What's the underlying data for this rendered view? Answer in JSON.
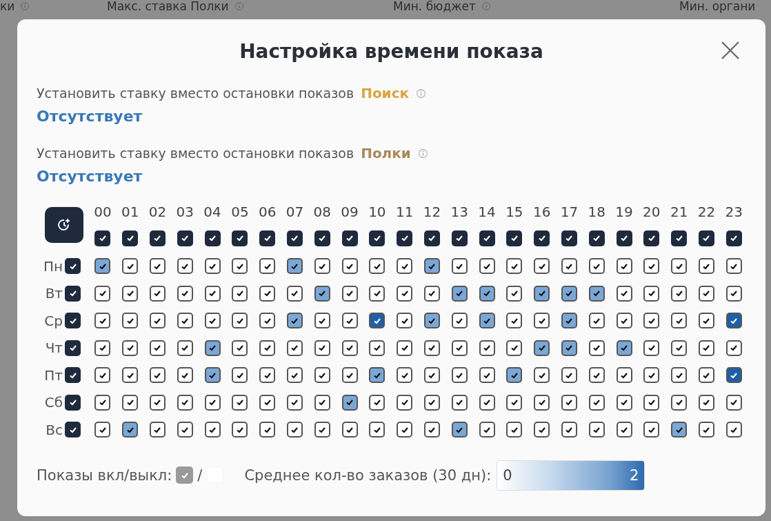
{
  "background_header": {
    "columns": [
      "ки",
      "Макс. ставка Полки",
      "Мин. бюджет",
      "Мин. органи"
    ]
  },
  "dialog": {
    "title": "Настройка времени показа",
    "bid_settings": [
      {
        "label": "Установить ставку вместо остановки показов",
        "placement": "Поиск",
        "color": "#d9a441",
        "value": "Отсутствует"
      },
      {
        "label": "Установить ставку вместо остановки показов",
        "placement": "Полки",
        "color": "#a98a5c",
        "value": "Отсутствует"
      }
    ],
    "schedule": {
      "hours": [
        "00",
        "01",
        "02",
        "03",
        "04",
        "05",
        "06",
        "07",
        "08",
        "09",
        "10",
        "11",
        "12",
        "13",
        "14",
        "15",
        "16",
        "17",
        "18",
        "19",
        "20",
        "21",
        "22",
        "23"
      ],
      "hour_checks": [
        true,
        true,
        true,
        true,
        true,
        true,
        true,
        true,
        true,
        true,
        true,
        true,
        true,
        true,
        true,
        true,
        true,
        true,
        true,
        true,
        true,
        true,
        true,
        true
      ],
      "days": [
        {
          "label": "Пн",
          "checked": true,
          "cells": [
            {
              "checked": true,
              "color": "#7aa7d6"
            },
            {
              "checked": true,
              "color": "#ffffff"
            },
            {
              "checked": true,
              "color": "#ffffff"
            },
            {
              "checked": true,
              "color": "#ffffff"
            },
            {
              "checked": true,
              "color": "#ffffff"
            },
            {
              "checked": true,
              "color": "#ffffff"
            },
            {
              "checked": true,
              "color": "#ffffff"
            },
            {
              "checked": true,
              "color": "#7aa7d6"
            },
            {
              "checked": true,
              "color": "#ffffff"
            },
            {
              "checked": true,
              "color": "#ffffff"
            },
            {
              "checked": true,
              "color": "#ffffff"
            },
            {
              "checked": true,
              "color": "#ffffff"
            },
            {
              "checked": true,
              "color": "#7aa7d6"
            },
            {
              "checked": true,
              "color": "#ffffff"
            },
            {
              "checked": true,
              "color": "#ffffff"
            },
            {
              "checked": true,
              "color": "#ffffff"
            },
            {
              "checked": true,
              "color": "#ffffff"
            },
            {
              "checked": true,
              "color": "#ffffff"
            },
            {
              "checked": true,
              "color": "#ffffff"
            },
            {
              "checked": true,
              "color": "#ffffff"
            },
            {
              "checked": true,
              "color": "#ffffff"
            },
            {
              "checked": true,
              "color": "#ffffff"
            },
            {
              "checked": true,
              "color": "#ffffff"
            },
            {
              "checked": true,
              "color": "#ffffff"
            }
          ]
        },
        {
          "label": "Вт",
          "checked": true,
          "cells": [
            {
              "checked": true,
              "color": "#ffffff"
            },
            {
              "checked": true,
              "color": "#ffffff"
            },
            {
              "checked": true,
              "color": "#ffffff"
            },
            {
              "checked": true,
              "color": "#ffffff"
            },
            {
              "checked": true,
              "color": "#ffffff"
            },
            {
              "checked": true,
              "color": "#ffffff"
            },
            {
              "checked": true,
              "color": "#ffffff"
            },
            {
              "checked": true,
              "color": "#ffffff"
            },
            {
              "checked": true,
              "color": "#7aa7d6"
            },
            {
              "checked": true,
              "color": "#ffffff"
            },
            {
              "checked": true,
              "color": "#ffffff"
            },
            {
              "checked": true,
              "color": "#ffffff"
            },
            {
              "checked": true,
              "color": "#ffffff"
            },
            {
              "checked": true,
              "color": "#7aa7d6"
            },
            {
              "checked": true,
              "color": "#7aa7d6"
            },
            {
              "checked": true,
              "color": "#ffffff"
            },
            {
              "checked": true,
              "color": "#7aa7d6"
            },
            {
              "checked": true,
              "color": "#7aa7d6"
            },
            {
              "checked": true,
              "color": "#7aa7d6"
            },
            {
              "checked": true,
              "color": "#ffffff"
            },
            {
              "checked": true,
              "color": "#ffffff"
            },
            {
              "checked": true,
              "color": "#ffffff"
            },
            {
              "checked": true,
              "color": "#ffffff"
            },
            {
              "checked": true,
              "color": "#ffffff"
            }
          ]
        },
        {
          "label": "Ср",
          "checked": true,
          "cells": [
            {
              "checked": true,
              "color": "#ffffff"
            },
            {
              "checked": true,
              "color": "#ffffff"
            },
            {
              "checked": true,
              "color": "#ffffff"
            },
            {
              "checked": true,
              "color": "#ffffff"
            },
            {
              "checked": true,
              "color": "#ffffff"
            },
            {
              "checked": true,
              "color": "#ffffff"
            },
            {
              "checked": true,
              "color": "#ffffff"
            },
            {
              "checked": true,
              "color": "#7aa7d6"
            },
            {
              "checked": true,
              "color": "#ffffff"
            },
            {
              "checked": true,
              "color": "#ffffff"
            },
            {
              "checked": true,
              "color": "#1f5fa8"
            },
            {
              "checked": true,
              "color": "#ffffff"
            },
            {
              "checked": true,
              "color": "#7aa7d6"
            },
            {
              "checked": true,
              "color": "#ffffff"
            },
            {
              "checked": true,
              "color": "#7aa7d6"
            },
            {
              "checked": true,
              "color": "#ffffff"
            },
            {
              "checked": true,
              "color": "#ffffff"
            },
            {
              "checked": true,
              "color": "#7aa7d6"
            },
            {
              "checked": true,
              "color": "#ffffff"
            },
            {
              "checked": true,
              "color": "#ffffff"
            },
            {
              "checked": true,
              "color": "#ffffff"
            },
            {
              "checked": true,
              "color": "#ffffff"
            },
            {
              "checked": true,
              "color": "#ffffff"
            },
            {
              "checked": true,
              "color": "#1f5fa8"
            }
          ]
        },
        {
          "label": "Чт",
          "checked": true,
          "cells": [
            {
              "checked": true,
              "color": "#ffffff"
            },
            {
              "checked": true,
              "color": "#ffffff"
            },
            {
              "checked": true,
              "color": "#ffffff"
            },
            {
              "checked": true,
              "color": "#ffffff"
            },
            {
              "checked": true,
              "color": "#7aa7d6"
            },
            {
              "checked": true,
              "color": "#ffffff"
            },
            {
              "checked": true,
              "color": "#ffffff"
            },
            {
              "checked": true,
              "color": "#ffffff"
            },
            {
              "checked": true,
              "color": "#ffffff"
            },
            {
              "checked": true,
              "color": "#ffffff"
            },
            {
              "checked": true,
              "color": "#ffffff"
            },
            {
              "checked": true,
              "color": "#ffffff"
            },
            {
              "checked": true,
              "color": "#ffffff"
            },
            {
              "checked": true,
              "color": "#ffffff"
            },
            {
              "checked": true,
              "color": "#ffffff"
            },
            {
              "checked": true,
              "color": "#ffffff"
            },
            {
              "checked": true,
              "color": "#7aa7d6"
            },
            {
              "checked": true,
              "color": "#7aa7d6"
            },
            {
              "checked": true,
              "color": "#ffffff"
            },
            {
              "checked": true,
              "color": "#7aa7d6"
            },
            {
              "checked": true,
              "color": "#ffffff"
            },
            {
              "checked": true,
              "color": "#ffffff"
            },
            {
              "checked": true,
              "color": "#ffffff"
            },
            {
              "checked": true,
              "color": "#ffffff"
            }
          ]
        },
        {
          "label": "Пт",
          "checked": true,
          "cells": [
            {
              "checked": true,
              "color": "#ffffff"
            },
            {
              "checked": true,
              "color": "#ffffff"
            },
            {
              "checked": true,
              "color": "#ffffff"
            },
            {
              "checked": true,
              "color": "#ffffff"
            },
            {
              "checked": true,
              "color": "#7aa7d6"
            },
            {
              "checked": true,
              "color": "#ffffff"
            },
            {
              "checked": true,
              "color": "#ffffff"
            },
            {
              "checked": true,
              "color": "#ffffff"
            },
            {
              "checked": true,
              "color": "#ffffff"
            },
            {
              "checked": true,
              "color": "#ffffff"
            },
            {
              "checked": true,
              "color": "#7aa7d6"
            },
            {
              "checked": true,
              "color": "#ffffff"
            },
            {
              "checked": true,
              "color": "#ffffff"
            },
            {
              "checked": true,
              "color": "#ffffff"
            },
            {
              "checked": true,
              "color": "#ffffff"
            },
            {
              "checked": true,
              "color": "#7aa7d6"
            },
            {
              "checked": true,
              "color": "#ffffff"
            },
            {
              "checked": true,
              "color": "#ffffff"
            },
            {
              "checked": true,
              "color": "#ffffff"
            },
            {
              "checked": true,
              "color": "#ffffff"
            },
            {
              "checked": true,
              "color": "#ffffff"
            },
            {
              "checked": true,
              "color": "#ffffff"
            },
            {
              "checked": true,
              "color": "#ffffff"
            },
            {
              "checked": true,
              "color": "#1f5fa8"
            }
          ]
        },
        {
          "label": "Сб",
          "checked": true,
          "cells": [
            {
              "checked": true,
              "color": "#ffffff"
            },
            {
              "checked": true,
              "color": "#ffffff"
            },
            {
              "checked": true,
              "color": "#ffffff"
            },
            {
              "checked": true,
              "color": "#ffffff"
            },
            {
              "checked": true,
              "color": "#ffffff"
            },
            {
              "checked": true,
              "color": "#ffffff"
            },
            {
              "checked": true,
              "color": "#ffffff"
            },
            {
              "checked": true,
              "color": "#ffffff"
            },
            {
              "checked": true,
              "color": "#ffffff"
            },
            {
              "checked": true,
              "color": "#7aa7d6"
            },
            {
              "checked": true,
              "color": "#ffffff"
            },
            {
              "checked": true,
              "color": "#ffffff"
            },
            {
              "checked": true,
              "color": "#ffffff"
            },
            {
              "checked": true,
              "color": "#ffffff"
            },
            {
              "checked": true,
              "color": "#ffffff"
            },
            {
              "checked": true,
              "color": "#ffffff"
            },
            {
              "checked": true,
              "color": "#ffffff"
            },
            {
              "checked": true,
              "color": "#ffffff"
            },
            {
              "checked": true,
              "color": "#ffffff"
            },
            {
              "checked": true,
              "color": "#ffffff"
            },
            {
              "checked": true,
              "color": "#ffffff"
            },
            {
              "checked": true,
              "color": "#ffffff"
            },
            {
              "checked": true,
              "color": "#ffffff"
            },
            {
              "checked": true,
              "color": "#ffffff"
            }
          ]
        },
        {
          "label": "Вс",
          "checked": true,
          "cells": [
            {
              "checked": true,
              "color": "#ffffff"
            },
            {
              "checked": true,
              "color": "#7aa7d6"
            },
            {
              "checked": true,
              "color": "#ffffff"
            },
            {
              "checked": true,
              "color": "#ffffff"
            },
            {
              "checked": true,
              "color": "#ffffff"
            },
            {
              "checked": true,
              "color": "#ffffff"
            },
            {
              "checked": true,
              "color": "#ffffff"
            },
            {
              "checked": true,
              "color": "#ffffff"
            },
            {
              "checked": true,
              "color": "#ffffff"
            },
            {
              "checked": true,
              "color": "#ffffff"
            },
            {
              "checked": true,
              "color": "#ffffff"
            },
            {
              "checked": true,
              "color": "#ffffff"
            },
            {
              "checked": true,
              "color": "#ffffff"
            },
            {
              "checked": true,
              "color": "#7aa7d6"
            },
            {
              "checked": true,
              "color": "#ffffff"
            },
            {
              "checked": true,
              "color": "#ffffff"
            },
            {
              "checked": true,
              "color": "#ffffff"
            },
            {
              "checked": true,
              "color": "#ffffff"
            },
            {
              "checked": true,
              "color": "#ffffff"
            },
            {
              "checked": true,
              "color": "#ffffff"
            },
            {
              "checked": true,
              "color": "#ffffff"
            },
            {
              "checked": true,
              "color": "#7aa7d6"
            },
            {
              "checked": true,
              "color": "#ffffff"
            },
            {
              "checked": true,
              "color": "#ffffff"
            }
          ]
        }
      ]
    },
    "legend": {
      "toggle_label": "Показы вкл/выкл:",
      "on_checked": true,
      "separator": "/",
      "off_checked": false,
      "scale_label": "Среднее кол-во заказов (30 дн):",
      "scale_min": "0",
      "scale_max": "2"
    }
  }
}
